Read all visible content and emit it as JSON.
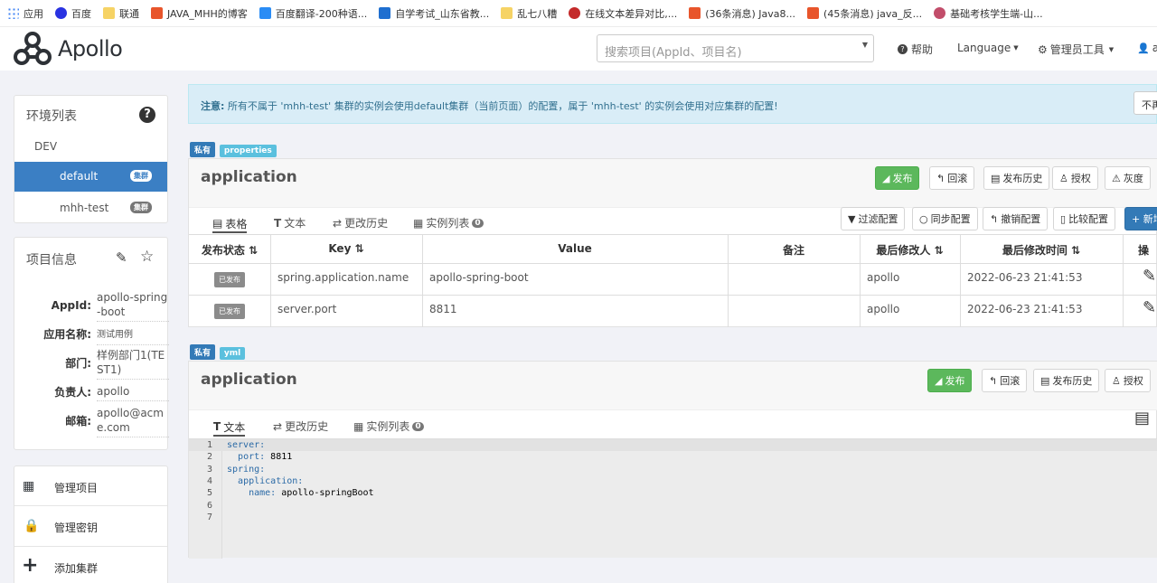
{
  "bookmarks": [
    {
      "label": "应用",
      "color": "#4285f4"
    },
    {
      "label": "百度",
      "color": "#2932e1"
    },
    {
      "label": "联通",
      "color": "#f6d365"
    },
    {
      "label": "JAVA_MHH的博客",
      "color": "#e8552b"
    },
    {
      "label": "百度翻译-200种语...",
      "color": "#2a8cf5"
    },
    {
      "label": "自学考试_山东省教...",
      "color": "#1f6fd0"
    },
    {
      "label": "乱七八糟",
      "color": "#f6d365"
    },
    {
      "label": "在线文本差异对比,...",
      "color": "#c42a2a"
    },
    {
      "label": "(36条消息) Java8...",
      "color": "#e8552b"
    },
    {
      "label": "(45条消息) java_反...",
      "color": "#e8552b"
    },
    {
      "label": "基础考核学生端-山...",
      "color": "#c24d6a"
    }
  ],
  "nav": {
    "logo": "Apollo",
    "search_placeholder": "搜索项目(AppId、项目名)",
    "help": "帮助",
    "language": "Language",
    "admin": "管理员工具",
    "user": "a"
  },
  "env": {
    "title": "环境列表",
    "env_name": "DEV",
    "clusters": [
      {
        "name": "default",
        "badge": "集群"
      },
      {
        "name": "mhh-test",
        "badge": "集群"
      }
    ]
  },
  "project": {
    "title": "项目信息",
    "fields": [
      {
        "label": "AppId:",
        "value": "apollo-spring-boot"
      },
      {
        "label": "应用名称:",
        "value": "测试用例"
      },
      {
        "label": "部门:",
        "value": "样例部门1(TEST1)"
      },
      {
        "label": "负责人:",
        "value": "apollo"
      },
      {
        "label": "邮箱:",
        "value": "apollo@acme.com"
      }
    ]
  },
  "actions": [
    {
      "label": "管理项目"
    },
    {
      "label": "管理密钥"
    },
    {
      "label": "添加集群"
    }
  ],
  "notice": {
    "prefix": "注意:",
    "text": " 所有不属于 'mhh-test' 集群的实例会使用default集群（当前页面）的配置，属于 'mhh-test' 的实例会使用对应集群的配置!",
    "right_button": "不再"
  },
  "ns1": {
    "tag_private": "私有",
    "tag_format": "properties",
    "name": "application",
    "buttons": {
      "publish": "发布",
      "rollback": "回滚",
      "history": "发布历史",
      "auth": "授权",
      "gray": "灰度"
    },
    "tabs": {
      "table": "表格",
      "text": "文本",
      "history": "更改历史",
      "instances": "实例列表",
      "instances_count": "0"
    },
    "tools": {
      "filter": "过滤配置",
      "sync": "同步配置",
      "revoke": "撤销配置",
      "compare": "比较配置",
      "add": "+ 新增"
    },
    "headers": {
      "status": "发布状态",
      "key": "Key",
      "value": "Value",
      "comment": "备注",
      "modifier": "最后修改人",
      "time": "最后修改时间",
      "op": "操"
    },
    "rows": [
      {
        "status": "已发布",
        "key": "spring.application.name",
        "value": "apollo-spring-boot",
        "comment": "",
        "modifier": "apollo",
        "time": "2022-06-23 21:41:53"
      },
      {
        "status": "已发布",
        "key": "server.port",
        "value": "8811",
        "comment": "",
        "modifier": "apollo",
        "time": "2022-06-23 21:41:53"
      }
    ]
  },
  "ns2": {
    "tag_private": "私有",
    "tag_format": "yml",
    "name": "application",
    "buttons": {
      "publish": "发布",
      "rollback": "回滚",
      "history": "发布历史",
      "auth": "授权"
    },
    "tabs": {
      "text": "文本",
      "history": "更改历史",
      "instances": "实例列表",
      "instances_count": "0"
    },
    "code": [
      {
        "n": "1",
        "t": "server:"
      },
      {
        "n": "2",
        "t": "  port: 8811"
      },
      {
        "n": "3",
        "t": "spring:"
      },
      {
        "n": "4",
        "t": "  application:"
      },
      {
        "n": "5",
        "t": "    name: apollo-springBoot"
      },
      {
        "n": "6",
        "t": ""
      },
      {
        "n": "7",
        "t": ""
      }
    ]
  }
}
